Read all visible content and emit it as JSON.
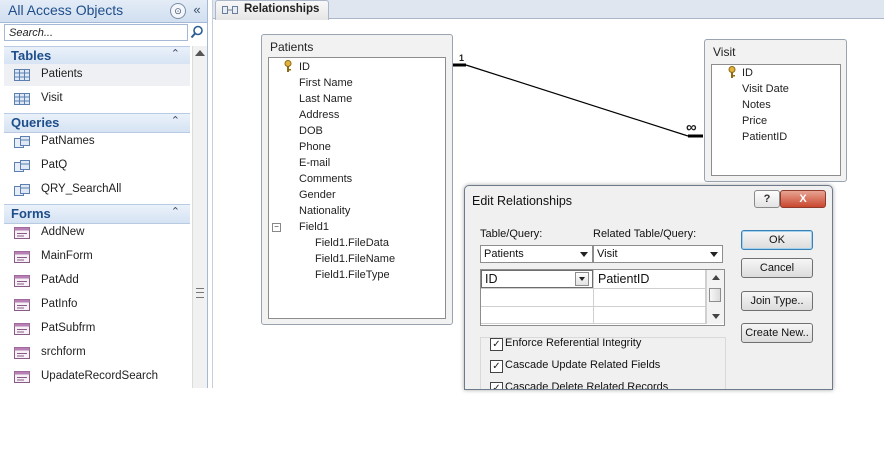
{
  "nav": {
    "title": "All Access Objects",
    "search_placeholder": "Search...",
    "groups": [
      {
        "label": "Tables",
        "items": [
          {
            "label": "Patients"
          },
          {
            "label": "Visit"
          }
        ]
      },
      {
        "label": "Queries",
        "items": [
          {
            "label": "PatNames"
          },
          {
            "label": "PatQ"
          },
          {
            "label": "QRY_SearchAll"
          }
        ]
      },
      {
        "label": "Forms",
        "items": [
          {
            "label": "AddNew"
          },
          {
            "label": "MainForm"
          },
          {
            "label": "PatAdd"
          },
          {
            "label": "PatInfo"
          },
          {
            "label": "PatSubfrm"
          },
          {
            "label": "srchform"
          },
          {
            "label": "UpadateRecordSearch"
          }
        ]
      }
    ],
    "chevron_glyph": "«",
    "dropdown_glyph": "⊙"
  },
  "workspace": {
    "tab_label": "Relationships",
    "tables": {
      "patients": {
        "title": "Patients",
        "fields": [
          "ID",
          "First Name",
          "Last Name",
          "Address",
          "DOB",
          "Phone",
          "E-mail",
          "Comments",
          "Gender",
          "Nationality",
          "Field1",
          "Field1.FileData",
          "Field1.FileName",
          "Field1.FileType"
        ],
        "expander": "−"
      },
      "visit": {
        "title": "Visit",
        "fields": [
          "ID",
          "Visit Date",
          "Notes",
          "Price",
          "PatientID"
        ]
      }
    },
    "relationship": {
      "one_label": "1",
      "many_label": "∞"
    }
  },
  "dialog": {
    "title": "Edit Relationships",
    "help": "?",
    "close": "X",
    "table_query_label": "Table/Query:",
    "related_label": "Related Table/Query:",
    "table_value": "Patients",
    "related_value": "Visit",
    "grid_rows": [
      {
        "left": "ID",
        "right": "PatientID"
      },
      {
        "left": "",
        "right": ""
      },
      {
        "left": "",
        "right": ""
      }
    ],
    "options": [
      {
        "label": "Enforce Referential Integrity",
        "checked": "✓"
      },
      {
        "label": "Cascade Update Related Fields",
        "checked": "✓"
      },
      {
        "label": "Cascade Delete Related Records",
        "checked": "✓"
      }
    ],
    "buttons": {
      "ok": "OK",
      "cancel": "Cancel",
      "join_type": "Join Type..",
      "create_new": "Create New.."
    }
  },
  "colors": {
    "accent": "#1e4e8a",
    "nav_group_bg": "#dae6f4",
    "close_red": "#c9472f"
  }
}
